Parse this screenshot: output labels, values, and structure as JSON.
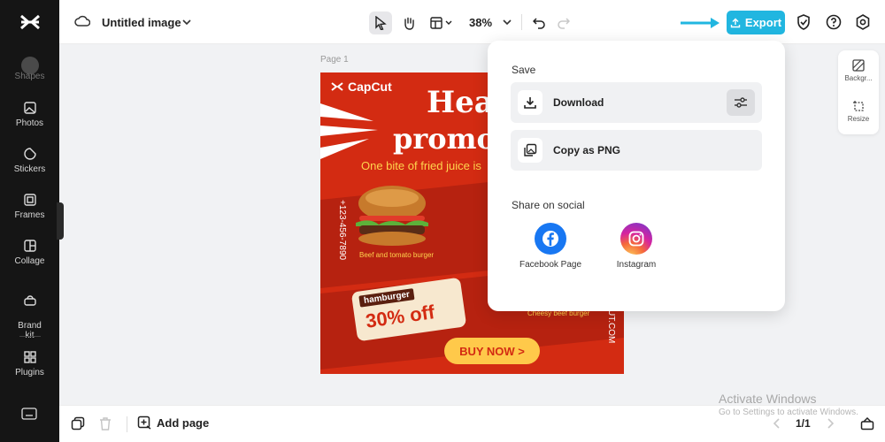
{
  "sidebar": {
    "logo": "capcut-logo",
    "shapes_label": "Shapes",
    "items": [
      {
        "label": "Photos",
        "icon": "image-icon"
      },
      {
        "label": "Stickers",
        "icon": "sticker-icon"
      },
      {
        "label": "Frames",
        "icon": "frame-icon"
      },
      {
        "label": "Collage",
        "icon": "collage-icon"
      },
      {
        "label": "Brand\nkit",
        "icon": "brand-kit-icon"
      },
      {
        "label": "Plugins",
        "icon": "plugins-icon"
      }
    ]
  },
  "topbar": {
    "title": "Untitled image",
    "zoom": "38%",
    "export_label": "Export"
  },
  "right_panel": {
    "background_label": "Backgr...",
    "resize_label": "Resize"
  },
  "canvas": {
    "page_label": "Page 1",
    "poster": {
      "brand": "CapCut",
      "headline_line1": "Hea",
      "headline_line2": "promo",
      "tagline": "One bite of fried juice is",
      "phone": "+123-456-7890",
      "burger_caption": "Beef and tomato burger",
      "tag_title": "hamburger",
      "tag_discount": "30% off",
      "cheesy_caption": "Cheesy beef burger",
      "website": "UT.COM",
      "cta": "BUY NOW >"
    }
  },
  "export_panel": {
    "save_heading": "Save",
    "download_label": "Download",
    "copy_label": "Copy as PNG",
    "share_heading": "Share on social",
    "facebook_label": "Facebook Page",
    "instagram_label": "Instagram"
  },
  "bottombar": {
    "add_page_label": "Add page",
    "page_count": "1/1"
  },
  "watermark": {
    "line1": "Activate Windows",
    "line2": "Go to Settings to activate Windows."
  },
  "colors": {
    "accent": "#21b6e0",
    "poster_red": "#d32b12",
    "facebook": "#1877f2"
  }
}
